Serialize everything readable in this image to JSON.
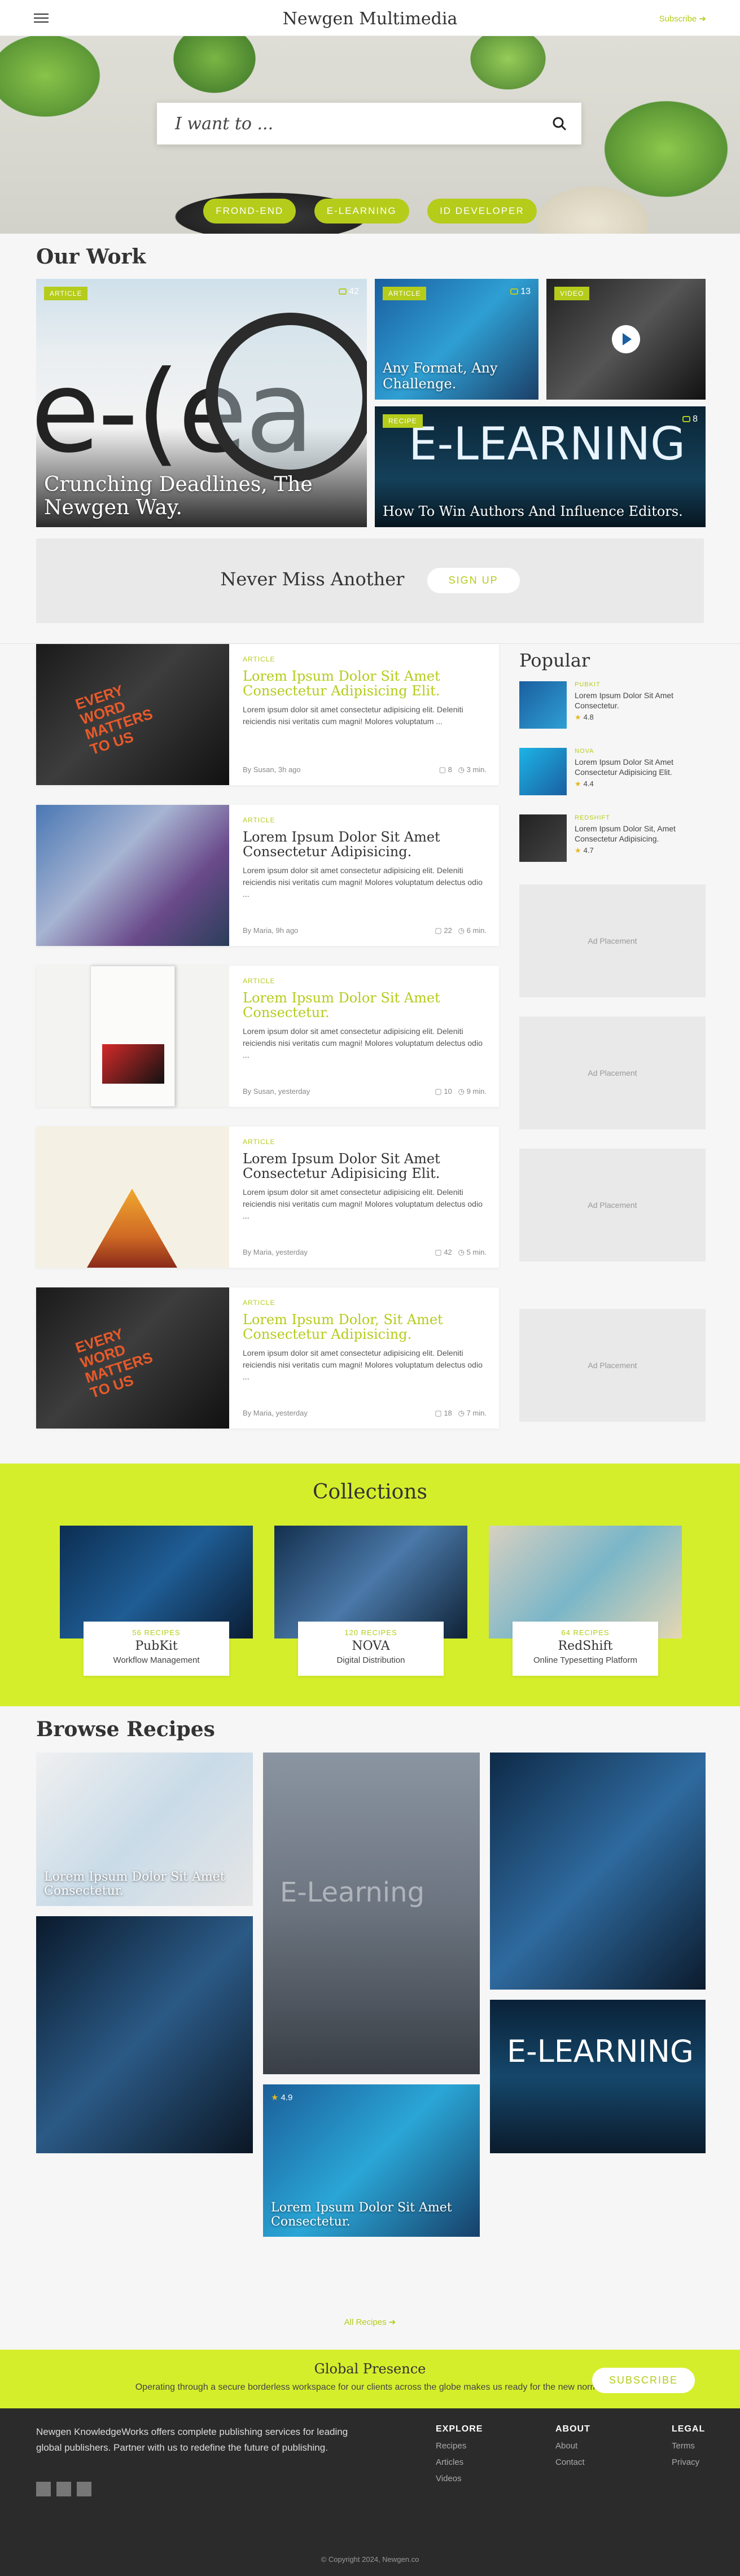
{
  "header": {
    "brand": "Newgen Multimedia",
    "subscribe": "Subscribe ➜"
  },
  "hero": {
    "search_placeholder": "I want to ...",
    "tags": [
      "FROND-END",
      "E-LEARNING",
      "ID DEVELOPER"
    ]
  },
  "our_work": {
    "title": "Our Work",
    "cards": [
      {
        "label": "ARTICLE",
        "count": "42",
        "caption": "Crunching Deadlines, The Newgen Way.",
        "art": "e-(ea"
      },
      {
        "label": "ARTICLE",
        "count": "13",
        "caption": "Any Format, Any Challenge."
      },
      {
        "label": "VIDEO",
        "count": "",
        "caption": ""
      },
      {
        "label": "RECIPE",
        "count": "8",
        "caption": "How To Win Authors And Influence Editors.",
        "art": "E-LEARNING"
      }
    ]
  },
  "newsletter": {
    "text": "Never Miss Another",
    "button": "SIGN UP"
  },
  "articles": [
    {
      "kicker": "ARTICLE",
      "title": "Lorem Ipsum Dolor Sit Amet Consectetur Adipisicing Elit.",
      "excerpt": "Lorem ipsum dolor sit amet consectetur adipisicing elit. Deleniti reiciendis nisi veritatis cum magni! Molores voluptatum ...",
      "byline": "By Susan, 3h ago",
      "comments": "8",
      "read": "3 min."
    },
    {
      "kicker": "ARTICLE",
      "title": "Lorem Ipsum Dolor Sit Amet Consectetur Adipisicing.",
      "excerpt": "Lorem ipsum dolor sit amet consectetur adipisicing elit. Deleniti reiciendis nisi veritatis cum magni! Molores voluptatum delectus odio ...",
      "byline": "By Maria, 9h ago",
      "comments": "22",
      "read": "6 min."
    },
    {
      "kicker": "ARTICLE",
      "title": "Lorem Ipsum Dolor Sit Amet Consectetur.",
      "excerpt": "Lorem ipsum dolor sit amet consectetur adipisicing elit. Deleniti reiciendis nisi veritatis cum magni! Molores voluptatum delectus odio ...",
      "byline": "By Susan, yesterday",
      "comments": "10",
      "read": "9 min."
    },
    {
      "kicker": "ARTICLE",
      "title": "Lorem Ipsum Dolor Sit Amet Consectetur Adipisicing Elit.",
      "excerpt": "Lorem ipsum dolor sit amet consectetur adipisicing elit. Deleniti reiciendis nisi veritatis cum magni! Molores voluptatum delectus odio ...",
      "byline": "By Maria, yesterday",
      "comments": "42",
      "read": "5 min."
    },
    {
      "kicker": "ARTICLE",
      "title": "Lorem Ipsum Dolor, Sit Amet Consectetur Adipisicing.",
      "excerpt": "Lorem ipsum dolor sit amet consectetur adipisicing elit. Deleniti reiciendis nisi veritatis cum magni! Molores voluptatum delectus odio ...",
      "byline": "By Maria, yesterday",
      "comments": "18",
      "read": "7 min."
    }
  ],
  "sidebar": {
    "popular_title": "Popular",
    "items": [
      {
        "kicker": "PUBKIT",
        "title": "Lorem Ipsum Dolor Sit Amet Consectetur.",
        "rating": "4.8"
      },
      {
        "kicker": "NOVA",
        "title": "Lorem Ipsum Dolor Sit Amet Consectetur Adipisicing Elit.",
        "rating": "4.4"
      },
      {
        "kicker": "REDSHIFT",
        "title": "Lorem Ipsum Dolor Sit, Amet Consectetur Adipisicing.",
        "rating": "4.7"
      }
    ],
    "ad_label": "Ad Placement"
  },
  "collections": {
    "title": "Collections",
    "items": [
      {
        "count": "56 RECIPES",
        "name": "PubKit",
        "desc": "Workflow Management"
      },
      {
        "count": "120 RECIPES",
        "name": "NOVA",
        "desc": "Digital Distribution"
      },
      {
        "count": "64 RECIPES",
        "name": "RedShift",
        "desc": "Online Typesetting Platform"
      }
    ]
  },
  "browse": {
    "title": "Browse Recipes",
    "card_caption": "Lorem Ipsum Dolor Sit Amet Consectetur.",
    "card_rating": "4.9",
    "art_elearning": "E-Learning",
    "art_elearning2": "E-LEARNING",
    "all_link": "All Recipes ➜"
  },
  "presence": {
    "title": "Global Presence",
    "desc": "Operating through a secure borderless workspace for our clients across the globe makes us ready for the new normal",
    "button": "SUBSCRIBE"
  },
  "footer": {
    "about": "Newgen KnowledgeWorks offers complete publishing services for leading global publishers. Partner with us to redefine the future of publishing.",
    "cols": [
      {
        "heading": "EXPLORE",
        "links": [
          "Recipes",
          "Articles",
          "Videos"
        ]
      },
      {
        "heading": "ABOUT",
        "links": [
          "About",
          "Contact"
        ]
      },
      {
        "heading": "LEGAL",
        "links": [
          "Terms",
          "Privacy"
        ]
      }
    ],
    "copyright": "© Copyright 2024, Newgen.co"
  }
}
